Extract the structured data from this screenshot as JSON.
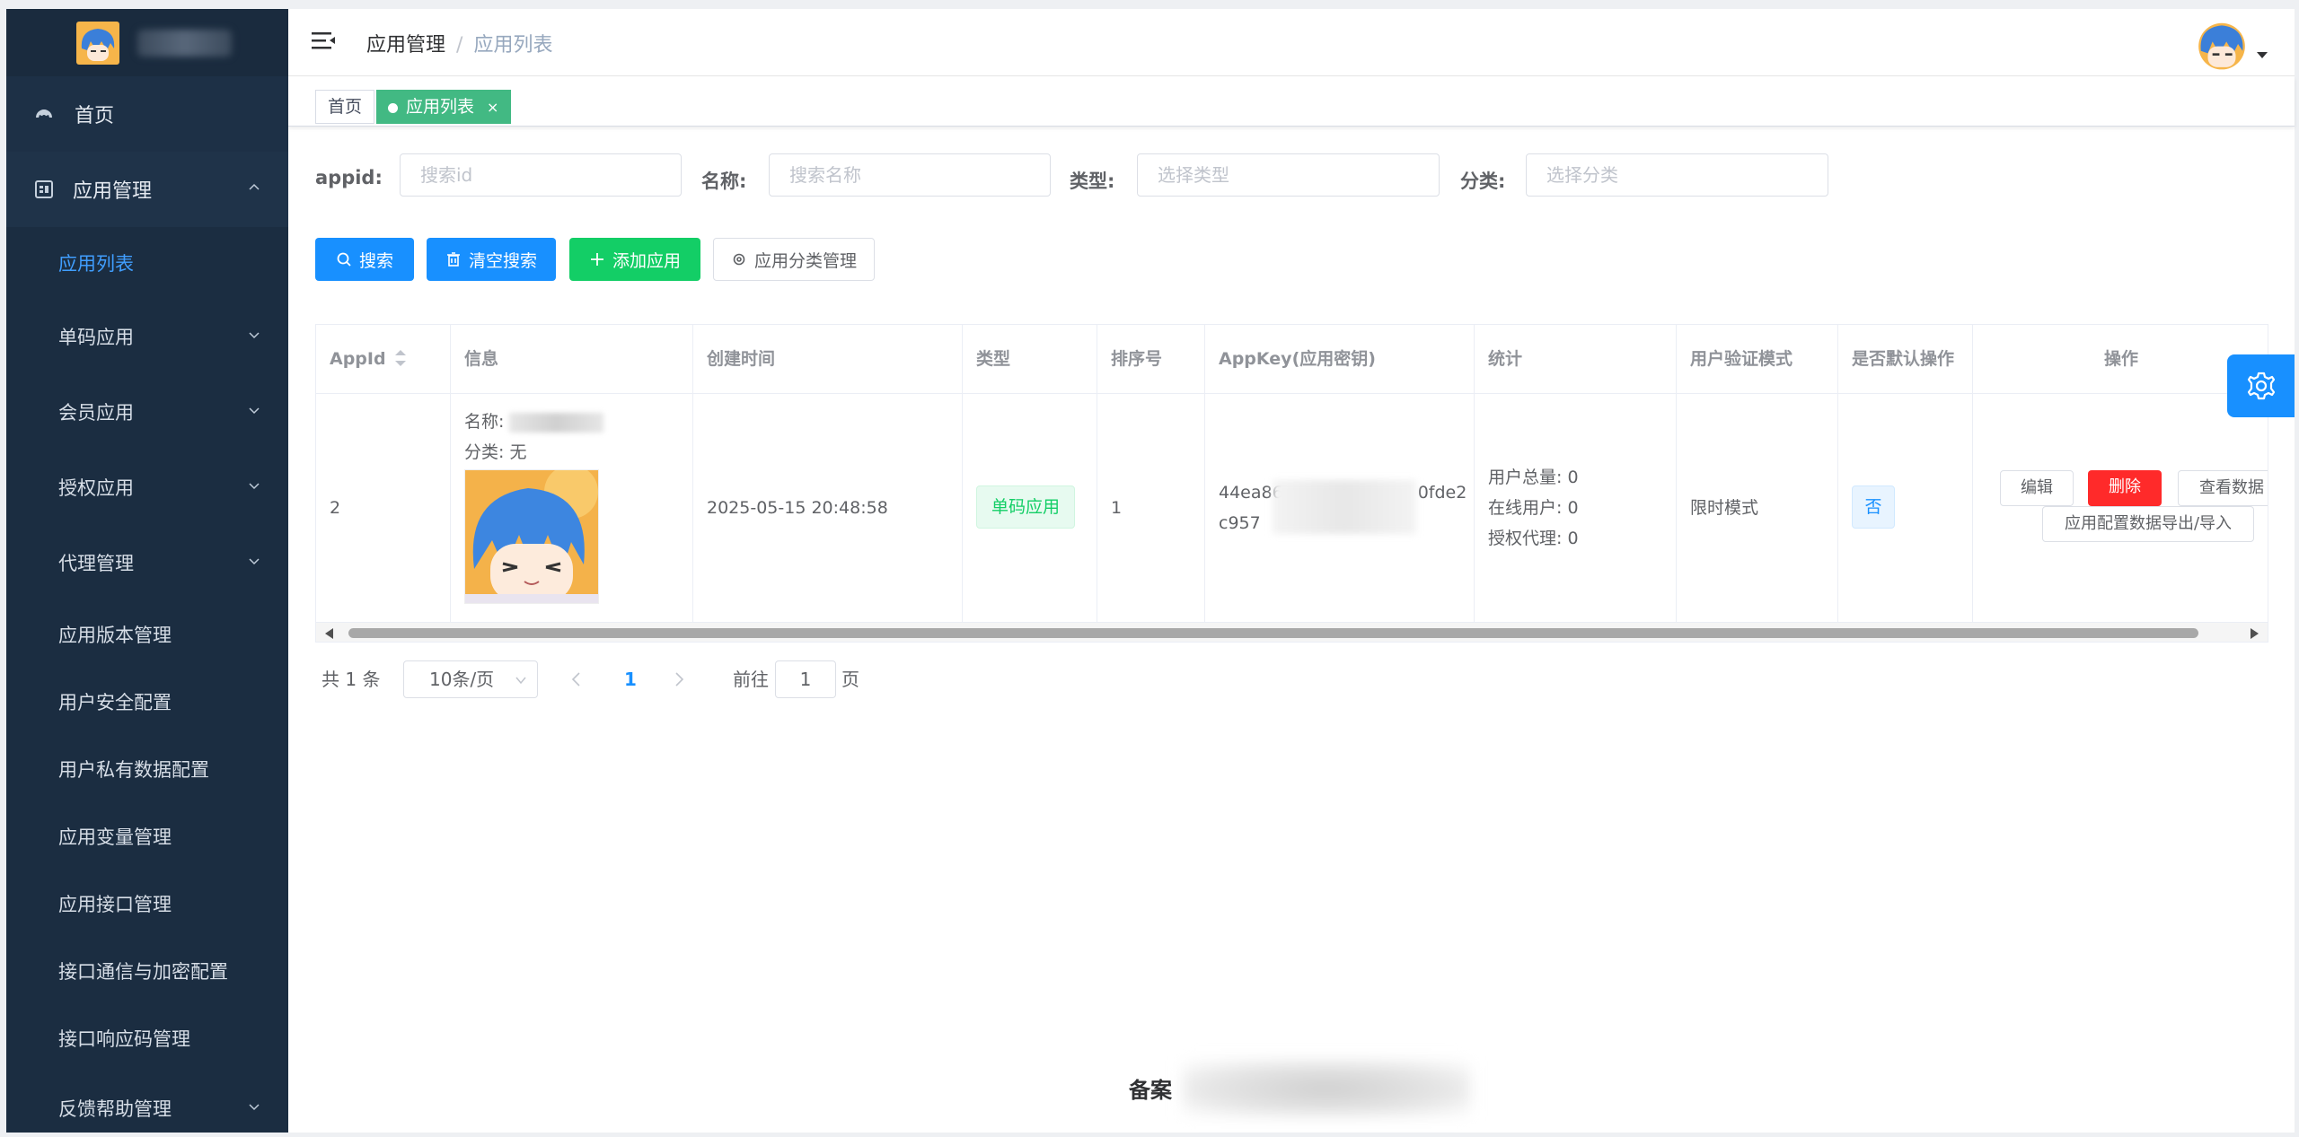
{
  "sidebar": {
    "top_item": "首页",
    "group": "应用管理",
    "items": [
      {
        "label": "应用列表"
      },
      {
        "label": "单码应用"
      },
      {
        "label": "会员应用"
      },
      {
        "label": "授权应用"
      },
      {
        "label": "代理管理"
      },
      {
        "label": "应用版本管理"
      },
      {
        "label": "用户安全配置"
      },
      {
        "label": "用户私有数据配置"
      },
      {
        "label": "应用变量管理"
      },
      {
        "label": "应用接口管理"
      },
      {
        "label": "接口通信与加密配置"
      },
      {
        "label": "接口响应码管理"
      },
      {
        "label": "反馈帮助管理"
      }
    ]
  },
  "header": {
    "breadcrumb": [
      "应用管理",
      "应用列表"
    ],
    "separator": "/"
  },
  "tags": {
    "home": "首页",
    "active": "应用列表",
    "close": "×"
  },
  "filters": {
    "appid_label": "appid:",
    "appid_placeholder": "搜索id",
    "name_label": "名称:",
    "name_placeholder": "搜索名称",
    "type_label": "类型:",
    "type_placeholder": "选择类型",
    "category_label": "分类:",
    "category_placeholder": "选择分类"
  },
  "buttons": {
    "search": "搜索",
    "clear": "清空搜索",
    "add": "添加应用",
    "category_mgmt": "应用分类管理"
  },
  "table": {
    "headers": [
      "AppId",
      "信息",
      "创建时间",
      "类型",
      "排序号",
      "AppKey(应用密钥)",
      "统计",
      "用户验证模式",
      "是否默认操作",
      "操作"
    ],
    "row": {
      "appid": "2",
      "info_name_label": "名称:",
      "info_category": "分类: 无",
      "created": "2025-05-15 20:48:58",
      "type": "单码应用",
      "order": "1",
      "appkey_line1_a": "44ea86",
      "appkey_line1_b": "0fde2",
      "appkey_line2": "c957",
      "stat_total": "用户总量: 0",
      "stat_online": "在线用户: 0",
      "stat_agent": "授权代理: 0",
      "verify_mode": "限时模式",
      "is_default": "否",
      "op_edit": "编辑",
      "op_delete": "删除",
      "op_view": "查看数据",
      "op_export": "应用配置数据导出/导入"
    }
  },
  "pagination": {
    "total": "共 1 条",
    "page_size": "10条/页",
    "current": "1",
    "goto_prefix": "前往",
    "goto_value": "1",
    "goto_suffix": "页"
  },
  "footer": {
    "label": "备案"
  },
  "colors": {
    "primary": "#1890ff",
    "success": "#13ce66",
    "danger": "#ff2a2a",
    "sidebar_bg": "#1d3046",
    "tag_active": "#42b983"
  }
}
